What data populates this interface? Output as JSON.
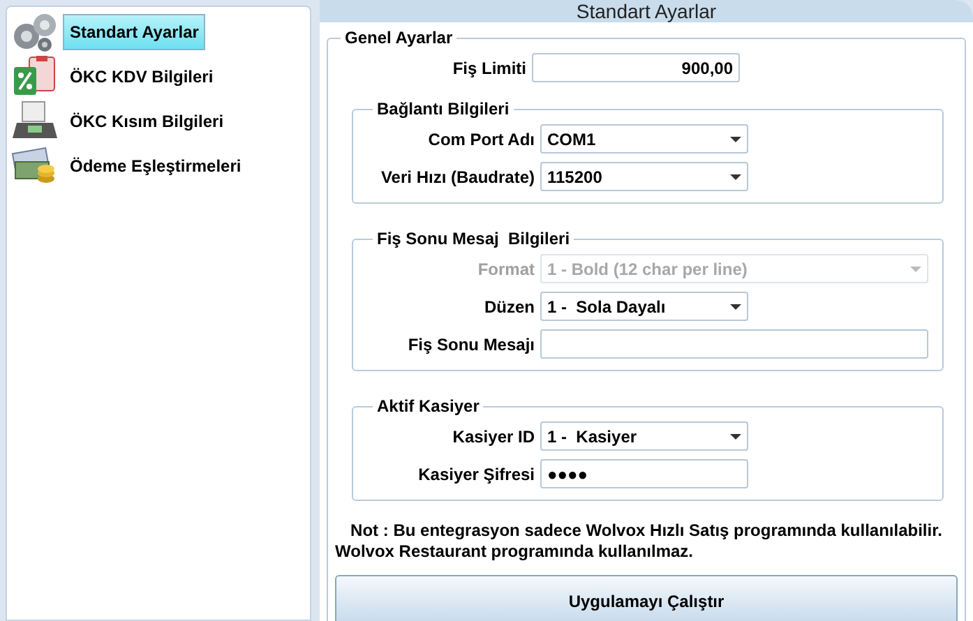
{
  "sidebar": {
    "items": [
      {
        "label": "Standart Ayarlar",
        "selected": true
      },
      {
        "label": "ÖKC KDV Bilgileri",
        "selected": false
      },
      {
        "label": "ÖKC Kısım Bilgileri",
        "selected": false
      },
      {
        "label": "Ödeme Eşleştirmeleri",
        "selected": false
      }
    ]
  },
  "panel": {
    "title": "Standart Ayarlar",
    "group": {
      "legend": "Genel Ayarlar",
      "fields": [
        {
          "label": "Fiş Limiti",
          "kind": "number",
          "value": "900,00",
          "disabled": false,
          "wide": false
        }
      ],
      "groups": [
        {
          "legend": "Bağlantı Bilgileri",
          "fields": [
            {
              "label": "Com Port Adı",
              "kind": "select",
              "value": "COM1",
              "disabled": false,
              "wide": false
            },
            {
              "label": "Veri Hızı (Baudrate)",
              "kind": "select",
              "value": "115200",
              "disabled": false,
              "wide": false
            }
          ]
        },
        {
          "legend": "Fiş Sonu Mesaj  Bilgileri",
          "fields": [
            {
              "label": "Format",
              "kind": "select",
              "value": "1 - Bold (12 char per line)",
              "disabled": true,
              "wide": true
            },
            {
              "label": "Düzen",
              "kind": "select",
              "value": "1 -  Sola Dayalı",
              "disabled": false,
              "wide": false
            },
            {
              "label": "Fiş Sonu Mesajı",
              "kind": "text",
              "disabled": false,
              "wide": true
            }
          ]
        },
        {
          "legend": "Aktif Kasiyer",
          "fields": [
            {
              "label": "Kasiyer ID",
              "kind": "select",
              "value": "1 -  Kasiyer",
              "disabled": false,
              "wide": false
            },
            {
              "label": "Kasiyer Şifresi",
              "kind": "password",
              "value": "●●●●",
              "disabled": false,
              "wide": false
            }
          ]
        }
      ],
      "note": [
        "Not : Bu entegrasyon sadece Wolvox Hızlı Satış programında kullanılabilir.",
        "Wolvox Restaurant programında kullanılmaz."
      ],
      "button": "Uygulamayı Çalıştır"
    }
  }
}
